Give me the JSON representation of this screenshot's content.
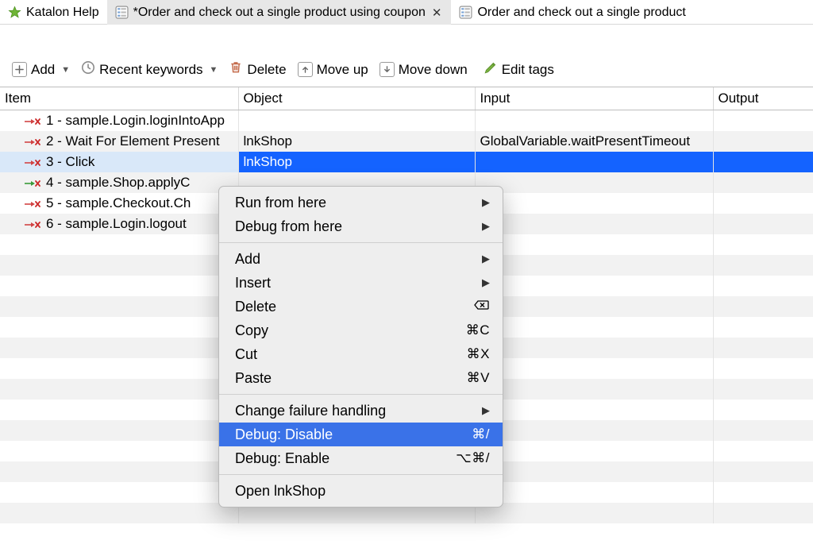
{
  "tabs": [
    {
      "label": "Katalon Help",
      "icon": "star",
      "active": false,
      "closeable": false
    },
    {
      "label": "*Order and check out a single product using coupon",
      "icon": "testcase",
      "active": true,
      "closeable": true
    },
    {
      "label": "Order and check out a single product",
      "icon": "testcase",
      "active": false,
      "closeable": false
    }
  ],
  "toolbar": {
    "add_label": "Add",
    "recent_label": "Recent keywords",
    "delete_label": "Delete",
    "moveup_label": "Move up",
    "movedown_label": "Move down",
    "edittags_label": "Edit tags"
  },
  "columns": {
    "item": "Item",
    "object": "Object",
    "input": "Input",
    "output": "Output"
  },
  "steps": [
    {
      "status": "red",
      "item": "1 - sample.Login.loginIntoApp",
      "object": "",
      "input": "",
      "output": ""
    },
    {
      "status": "red",
      "item": "2 - Wait For Element Present",
      "object": "lnkShop",
      "input": "GlobalVariable.waitPresentTimeout",
      "output": ""
    },
    {
      "status": "red",
      "item": "3 - Click",
      "object": "lnkShop",
      "input": "",
      "output": "",
      "selected": true
    },
    {
      "status": "green",
      "item": "4 - sample.Shop.applyC",
      "object": "",
      "input": "",
      "output": ""
    },
    {
      "status": "red",
      "item": "5 - sample.Checkout.Ch",
      "object": "",
      "input": "",
      "output": ""
    },
    {
      "status": "red",
      "item": "6 - sample.Login.logout",
      "object": "",
      "input": "",
      "output": ""
    }
  ],
  "context_menu": {
    "groups": [
      [
        {
          "label": "Run from here",
          "submenu": true
        },
        {
          "label": "Debug from here",
          "submenu": true
        }
      ],
      [
        {
          "label": "Add",
          "submenu": true
        },
        {
          "label": "Insert",
          "submenu": true
        },
        {
          "label": "Delete",
          "shortcut_icon": "delete"
        },
        {
          "label": "Copy",
          "shortcut": "⌘C"
        },
        {
          "label": "Cut",
          "shortcut": "⌘X"
        },
        {
          "label": "Paste",
          "shortcut": "⌘V"
        }
      ],
      [
        {
          "label": "Change failure handling",
          "submenu": true
        },
        {
          "label": "Debug: Disable",
          "shortcut": "⌘/",
          "highlight": true
        },
        {
          "label": "Debug: Enable",
          "shortcut": "⌥⌘/"
        }
      ],
      [
        {
          "label": "Open lnkShop"
        }
      ]
    ]
  }
}
